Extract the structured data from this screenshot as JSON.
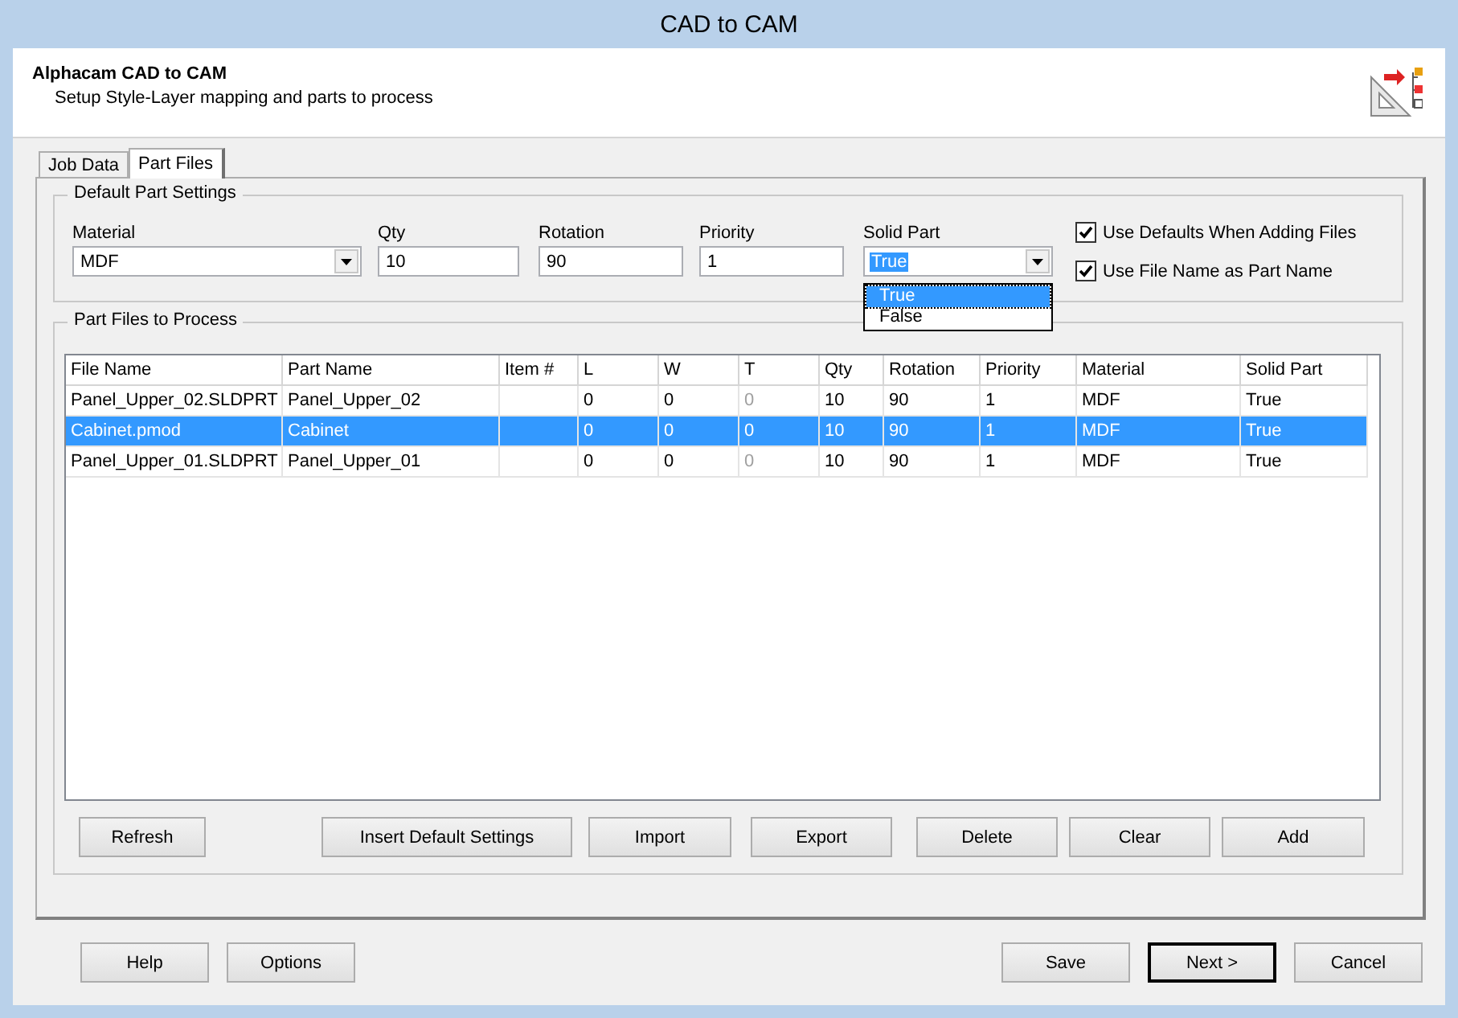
{
  "window": {
    "title": "CAD to CAM"
  },
  "header": {
    "title": "Alphacam CAD to CAM",
    "subtitle": "Setup Style-Layer mapping and parts to process"
  },
  "tabs": [
    {
      "label": "Job Data",
      "selected": false
    },
    {
      "label": "Part Files",
      "selected": true
    }
  ],
  "default_part_settings": {
    "title": "Default Part Settings",
    "fields": [
      {
        "kind": "combo",
        "label": "Material",
        "value": "MDF",
        "value_selected": false
      },
      {
        "kind": "text",
        "label": "Qty",
        "value": "10"
      },
      {
        "kind": "text",
        "label": "Rotation",
        "value": "90"
      },
      {
        "kind": "text",
        "label": "Priority",
        "value": "1"
      },
      {
        "kind": "combo",
        "label": "Solid Part",
        "value": "True",
        "value_selected": true,
        "expanded": true,
        "options": [
          {
            "label": "True",
            "selected": true
          },
          {
            "label": "False",
            "selected": false
          }
        ]
      }
    ],
    "checkboxes": [
      {
        "label": "Use Defaults When Adding Files",
        "checked": true
      },
      {
        "label": "Use File Name as Part Name",
        "checked": true
      }
    ]
  },
  "part_files": {
    "title": "Part Files to Process",
    "columns": [
      {
        "label": "File Name",
        "greyed": false
      },
      {
        "label": "Part Name",
        "greyed": false
      },
      {
        "label": "Item #"
      },
      {
        "label": "L",
        "greyed": false
      },
      {
        "label": "W",
        "greyed": false
      },
      {
        "label": "T",
        "greyed": true
      },
      {
        "label": "Qty",
        "greyed": false
      },
      {
        "label": "Rotation",
        "greyed": false
      },
      {
        "label": "Priority",
        "greyed": false
      },
      {
        "label": "Material",
        "greyed": false
      },
      {
        "label": "Solid Part",
        "greyed": false
      }
    ],
    "rows": [
      {
        "selected": false,
        "cells": [
          "Panel_Upper_02.SLDPRT",
          "Panel_Upper_02",
          "",
          "0",
          "0",
          "0",
          "10",
          "90",
          "1",
          "MDF",
          "True"
        ]
      },
      {
        "selected": true,
        "cells": [
          "Cabinet.pmod",
          "Cabinet",
          "",
          "0",
          "0",
          "0",
          "10",
          "90",
          "1",
          "MDF",
          "True"
        ]
      },
      {
        "selected": false,
        "cells": [
          "Panel_Upper_01.SLDPRT",
          "Panel_Upper_01",
          "",
          "0",
          "0",
          "0",
          "10",
          "90",
          "1",
          "MDF",
          "True"
        ]
      }
    ],
    "buttons": [
      "Refresh",
      "Insert Default Settings",
      "Import",
      "Export",
      "Delete",
      "Clear",
      "Add"
    ]
  },
  "footer": {
    "left_buttons": [
      {
        "label": "Help",
        "default": false
      },
      {
        "label": "Options",
        "default": false
      }
    ],
    "right_buttons": [
      {
        "label": "Save",
        "default": false
      },
      {
        "label": "Next >",
        "default": true
      },
      {
        "label": "Cancel",
        "default": false
      }
    ]
  }
}
